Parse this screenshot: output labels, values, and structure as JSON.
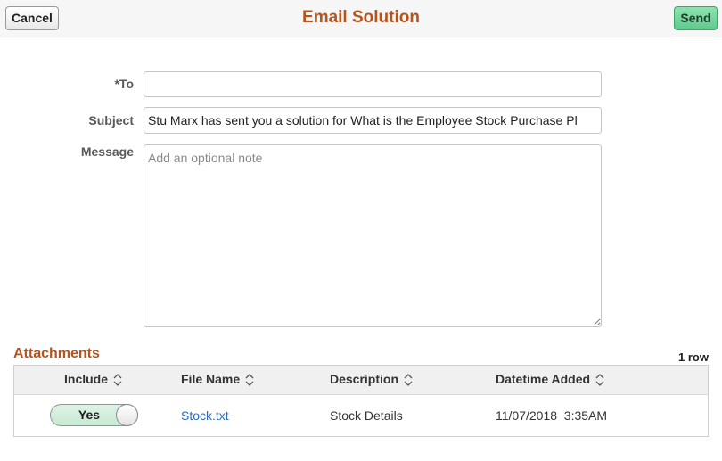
{
  "header": {
    "cancel_label": "Cancel",
    "title": "Email Solution",
    "send_label": "Send"
  },
  "form": {
    "to_label": "*To",
    "to_value": "",
    "subject_label": "Subject",
    "subject_value": "Stu Marx has sent you a solution for What is the Employee Stock Purchase Pl",
    "message_label": "Message",
    "message_value": "",
    "message_placeholder": "Add an optional note"
  },
  "attachments": {
    "title": "Attachments",
    "row_count": "1 row",
    "columns": [
      "Include",
      "File Name",
      "Description",
      "Datetime Added"
    ],
    "rows": [
      {
        "include": "Yes",
        "file_name": "Stock.txt",
        "description": "Stock Details",
        "datetime_added": "11/07/2018  3:35AM"
      }
    ]
  },
  "colors": {
    "title": "#b5541c",
    "send_button": "#6fd29a",
    "link": "#2a6bb8"
  },
  "icons": {
    "sort": "sort-up-down-icon",
    "resize": "resize-grip-icon"
  }
}
